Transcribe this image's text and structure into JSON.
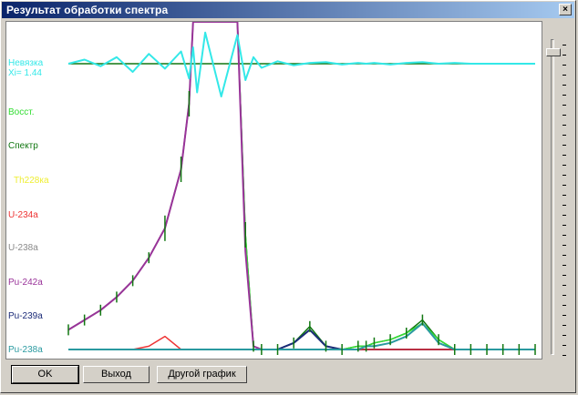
{
  "window": {
    "title": "Результат обработки спектра",
    "close_label": "×"
  },
  "legend": [
    {
      "text": "Невязка",
      "color": "#33e8e8"
    },
    {
      "text": "Xi= 1.44",
      "color": "#33e8e8"
    },
    {
      "text": "Восст.",
      "color": "#33dd33"
    },
    {
      "text": "Спектр",
      "color": "#117711"
    },
    {
      "text": "Th228ка",
      "color": "#eeee33"
    },
    {
      "text": "U-234a",
      "color": "#ee3333"
    },
    {
      "text": "U-238a",
      "color": "#8a8a8a"
    },
    {
      "text": "Pu-242a",
      "color": "#993399"
    },
    {
      "text": "Pu-239a",
      "color": "#1a2a77"
    },
    {
      "text": "Pu-238a",
      "color": "#2a9aa0"
    }
  ],
  "buttons": {
    "ok": "OK",
    "exit": "Выход",
    "other_graph": "Другой график"
  },
  "slider": {
    "position": 0.03
  },
  "chart_data": {
    "type": "line",
    "title": "",
    "xlabel": "",
    "ylabel": "",
    "grid": false,
    "legend_placement": "left",
    "x": [
      0,
      20,
      40,
      60,
      80,
      100,
      120,
      140,
      150,
      155,
      160,
      170,
      190,
      210,
      220,
      230,
      240,
      260,
      280,
      300,
      320,
      340,
      360,
      370,
      380,
      400,
      420,
      440,
      460,
      480,
      500,
      520,
      540,
      560,
      580
    ],
    "series": [
      {
        "name": "Спектр",
        "color": "#117711",
        "values": [
          0.06,
          0.09,
          0.12,
          0.16,
          0.21,
          0.28,
          0.37,
          0.55,
          0.75,
          1.0,
          1.0,
          1.0,
          1.0,
          1.0,
          0.35,
          0.01,
          0.0,
          0.0,
          0.02,
          0.07,
          0.01,
          0.0,
          0.01,
          0.01,
          0.02,
          0.03,
          0.05,
          0.09,
          0.03,
          0.0,
          0.0,
          0.0,
          0.0,
          0.0,
          0.0
        ]
      },
      {
        "name": "Восст.",
        "color": "#33dd33",
        "values": [
          0.06,
          0.09,
          0.12,
          0.16,
          0.21,
          0.28,
          0.37,
          0.55,
          0.75,
          1.0,
          1.0,
          1.0,
          1.0,
          1.0,
          0.35,
          0.01,
          0.0,
          0.0,
          0.02,
          0.06,
          0.01,
          0.0,
          0.01,
          0.01,
          0.02,
          0.03,
          0.05,
          0.08,
          0.03,
          0.0,
          0.0,
          0.0,
          0.0,
          0.0,
          0.0
        ]
      },
      {
        "name": "Pu-242a",
        "color": "#993399",
        "values": [
          0.06,
          0.09,
          0.12,
          0.16,
          0.21,
          0.28,
          0.37,
          0.55,
          0.75,
          1.0,
          1.0,
          1.0,
          1.0,
          1.0,
          0.3,
          0.01,
          0.0,
          0.0,
          0.0,
          0.0,
          0.0,
          0.0,
          0.0,
          0.0,
          0.0,
          0.0,
          0.0,
          0.0,
          0.0,
          0.0,
          0.0,
          0.0,
          0.0,
          0.0,
          0.0
        ]
      },
      {
        "name": "Pu-239a",
        "color": "#1a2a77",
        "values": [
          0,
          0,
          0,
          0,
          0,
          0,
          0,
          0,
          0,
          0,
          0,
          0,
          0,
          0,
          0,
          0,
          0.0,
          0.0,
          0.02,
          0.06,
          0.01,
          0.0,
          0.0,
          0.0,
          0.0,
          0.0,
          0.0,
          0.0,
          0.0,
          0.0,
          0.0,
          0.0,
          0.0,
          0.0,
          0.0
        ]
      },
      {
        "name": "U-234a",
        "color": "#ee3333",
        "values": [
          0,
          0,
          0,
          0,
          0.0,
          0.01,
          0.04,
          0.0,
          0,
          0,
          0,
          0,
          0,
          0,
          0,
          0,
          0,
          0,
          0,
          0,
          0,
          0,
          0,
          0,
          0,
          0,
          0,
          0,
          0,
          0,
          0,
          0,
          0,
          0,
          0
        ]
      },
      {
        "name": "Th228ка",
        "color": "#eeee33",
        "values": [
          0,
          0,
          0,
          0,
          0,
          0,
          0,
          0,
          0,
          0,
          0,
          0,
          0,
          0,
          0,
          0,
          0,
          0,
          0,
          0,
          0,
          0,
          0,
          0,
          0,
          0,
          0,
          0,
          0,
          0,
          0,
          0,
          0,
          0,
          0
        ]
      },
      {
        "name": "Pu-238a",
        "color": "#2a9aa0",
        "values": [
          0,
          0,
          0,
          0,
          0,
          0,
          0,
          0,
          0,
          0,
          0,
          0,
          0,
          0,
          0,
          0,
          0.0,
          0.0,
          0.0,
          0.0,
          0.0,
          0.0,
          0.0,
          0.01,
          0.01,
          0.02,
          0.04,
          0.08,
          0.02,
          0.0,
          0.0,
          0.0,
          0.0,
          0.0,
          0.0
        ]
      },
      {
        "name": "Невязка",
        "color": "#33e8e8",
        "values": [
          0,
          0.5,
          -0.3,
          0.8,
          -1.0,
          1.2,
          -0.6,
          1.5,
          -1.8,
          2.0,
          -3.5,
          3.8,
          -4.0,
          3.5,
          -2.0,
          0.8,
          -0.5,
          0.3,
          -0.2,
          0.1,
          0.2,
          -0.1,
          0.1,
          0.0,
          0.1,
          -0.1,
          0.1,
          0.2,
          0.0,
          0.1,
          0.0,
          0.0,
          0.0,
          0.0,
          0.0
        ]
      }
    ]
  }
}
